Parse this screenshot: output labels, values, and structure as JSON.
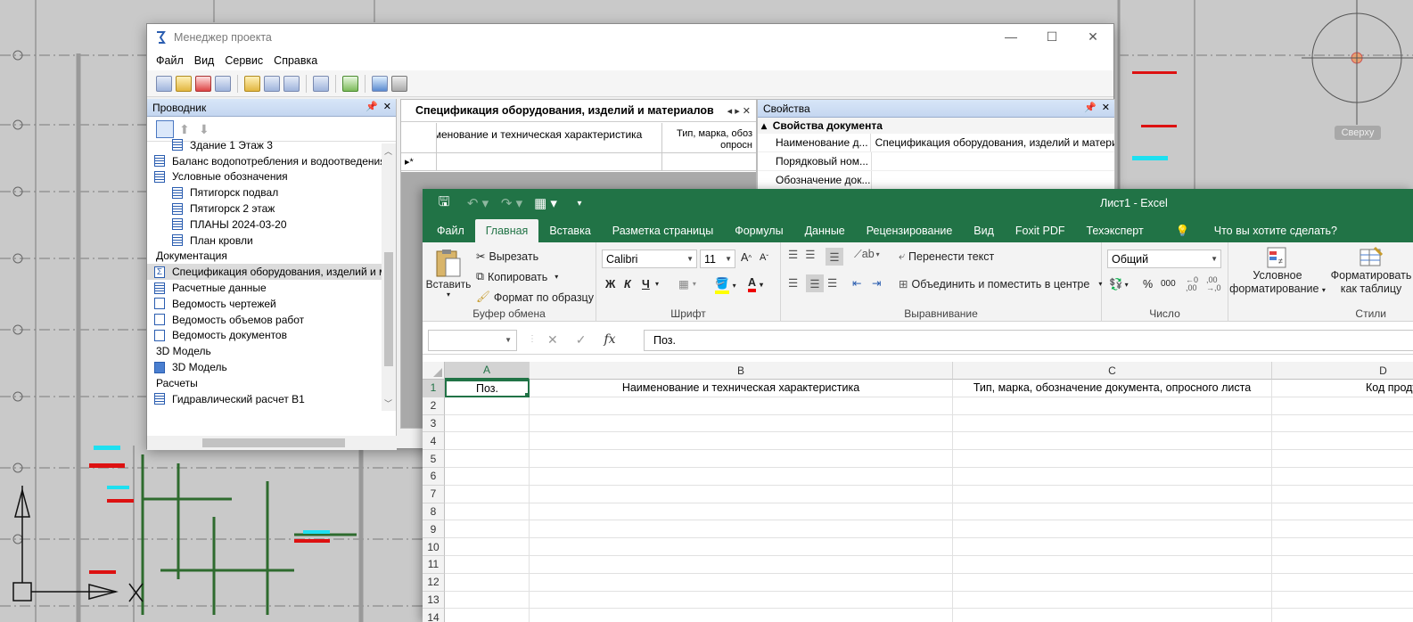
{
  "cad": {
    "view_label": "Сверху"
  },
  "project_manager": {
    "title": "Менеджер проекта",
    "window_controls": {
      "minimize": "—",
      "maximize": "☐",
      "close": "✕"
    },
    "menu": [
      "Файл",
      "Вид",
      "Сервис",
      "Справка"
    ],
    "explorer": {
      "title": "Проводник",
      "items": [
        {
          "label": "Здание 1 Этаж 3",
          "indent": 2,
          "icon": "table-icon"
        },
        {
          "label": "Баланс водопотребления и водоотведения",
          "indent": 1,
          "icon": "table-icon"
        },
        {
          "label": "Условные обозначения",
          "indent": 1,
          "icon": "table-icon"
        },
        {
          "label": "Пятигорск подвал",
          "indent": 2,
          "icon": "table-icon"
        },
        {
          "label": "Пятигорск 2 этаж",
          "indent": 2,
          "icon": "table-icon"
        },
        {
          "label": "ПЛАНЫ 2024-03-20",
          "indent": 2,
          "icon": "table-icon"
        },
        {
          "label": "План кровли",
          "indent": 2,
          "icon": "table-icon"
        },
        {
          "label": "Документация",
          "indent": 0,
          "icon": ""
        },
        {
          "label": "Спецификация оборудования, изделий и м",
          "indent": 1,
          "icon": "sum-icon",
          "selected": true
        },
        {
          "label": "Расчетные данные",
          "indent": 1,
          "icon": "table-icon"
        },
        {
          "label": "Ведомость чертежей",
          "indent": 1,
          "icon": "document-icon"
        },
        {
          "label": "Ведомость объемов работ",
          "indent": 1,
          "icon": "document-icon"
        },
        {
          "label": "Ведомость документов",
          "indent": 1,
          "icon": "document-icon"
        },
        {
          "label": "3D Модель",
          "indent": 0,
          "icon": ""
        },
        {
          "label": "3D Модель",
          "indent": 1,
          "icon": "cube-icon"
        },
        {
          "label": "Расчеты",
          "indent": 0,
          "icon": ""
        },
        {
          "label": "Гидравлический расчет В1",
          "indent": 1,
          "icon": "table-icon"
        }
      ]
    },
    "spec": {
      "tab_title": "Спецификация оборудования, изделий и материалов",
      "col1": "именование и техническая характеристика",
      "col2": "Тип, марка, обоз опросн",
      "new_row_marker": "▸*"
    },
    "properties": {
      "title": "Свойства",
      "section": "Свойства документа",
      "rows": [
        {
          "key": "Наименование д...",
          "value": "Спецификация оборудования, изделий и матери"
        },
        {
          "key": "Порядковый ном...",
          "value": ""
        },
        {
          "key": "Обозначение док...",
          "value": ""
        }
      ]
    }
  },
  "excel": {
    "title": "Лист1 - Excel",
    "tabs": [
      "Файл",
      "Главная",
      "Вставка",
      "Разметка страницы",
      "Формулы",
      "Данные",
      "Рецензирование",
      "Вид",
      "Foxit PDF",
      "Техэксперт"
    ],
    "active_tab": "Главная",
    "tell_me": "Что вы хотите сделать?",
    "clipboard": {
      "paste": "Вставить",
      "cut": "Вырезать",
      "copy": "Копировать",
      "format_painter": "Формат по образцу",
      "label": "Буфер обмена"
    },
    "font": {
      "name": "Calibri",
      "size": "11",
      "bold": "Ж",
      "italic": "К",
      "underline": "Ч",
      "label": "Шрифт"
    },
    "alignment": {
      "wrap": "Перенести текст",
      "merge": "Объединить и поместить в центре",
      "label": "Выравнивание"
    },
    "number": {
      "format": "Общий",
      "label": "Число",
      "percent": "%",
      "thousands": "000"
    },
    "styles": {
      "conditional": "Условное",
      "conditional2": "форматирование",
      "format_table": "Форматировать",
      "format_table2": "как таблицу",
      "label": "Стили"
    },
    "formula_bar": {
      "name_box": "",
      "value": "Поз.",
      "fx": "fx"
    },
    "columns": [
      "A",
      "B",
      "C",
      "D"
    ],
    "row_numbers": [
      "1",
      "2",
      "3",
      "4",
      "5",
      "6",
      "7",
      "8",
      "9",
      "10",
      "11",
      "12",
      "13",
      "14"
    ],
    "row1": [
      "Поз.",
      "Наименование и техническая характеристика",
      "Тип, марка, обозначение документа, опросного листа",
      "Код продукции"
    ]
  }
}
